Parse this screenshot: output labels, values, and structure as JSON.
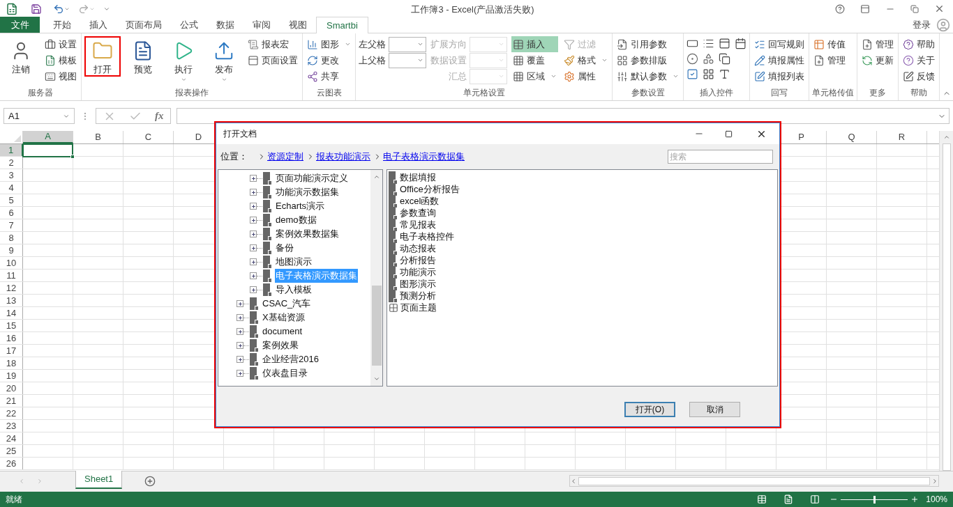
{
  "title_bar": {
    "title": "工作簿3 - Excel(产品激活失败)"
  },
  "tabs": [
    {
      "label": "文件",
      "kind": "file",
      "selected": false
    },
    {
      "label": "开始",
      "kind": "tab",
      "selected": false
    },
    {
      "label": "插入",
      "kind": "tab",
      "selected": false
    },
    {
      "label": "页面布局",
      "kind": "tab",
      "selected": false
    },
    {
      "label": "公式",
      "kind": "tab",
      "selected": false
    },
    {
      "label": "数据",
      "kind": "tab",
      "selected": false
    },
    {
      "label": "审阅",
      "kind": "tab",
      "selected": false
    },
    {
      "label": "视图",
      "kind": "tab",
      "selected": false
    },
    {
      "label": "Smartbi",
      "kind": "tab",
      "selected": true
    }
  ],
  "account": {
    "label": "登录"
  },
  "ribbon": {
    "groups": [
      {
        "label": "服务器",
        "columns": [
          {
            "kind": "large",
            "label": "注销",
            "highlighted": false,
            "has_caret": false
          },
          {
            "kind": "stack",
            "items": [
              {
                "label": "设置",
                "disabled": false,
                "selected": false,
                "has_caret": false
              },
              {
                "label": "模板",
                "disabled": false,
                "selected": false,
                "has_caret": false
              },
              {
                "label": "视图",
                "disabled": false,
                "selected": false,
                "has_caret": false
              }
            ]
          }
        ]
      },
      {
        "label": "报表操作",
        "columns": [
          {
            "kind": "large",
            "label": "打开",
            "highlighted": true,
            "has_caret": false
          },
          {
            "kind": "large",
            "label": "预览",
            "highlighted": false,
            "has_caret": false
          },
          {
            "kind": "large",
            "label": "执行",
            "highlighted": false,
            "has_caret": true
          },
          {
            "kind": "large",
            "label": "发布",
            "highlighted": false,
            "has_caret": true
          },
          {
            "kind": "stack",
            "items": [
              {
                "label": "报表宏",
                "disabled": false,
                "selected": false,
                "has_caret": false
              },
              {
                "label": "页面设置",
                "disabled": false,
                "selected": false,
                "has_caret": false
              }
            ]
          }
        ]
      },
      {
        "label": "云图表",
        "columns": [
          {
            "kind": "stack",
            "items": [
              {
                "label": "图形",
                "disabled": false,
                "selected": false,
                "has_caret": true
              },
              {
                "label": "更改",
                "disabled": false,
                "selected": false,
                "has_caret": false
              },
              {
                "label": "共享",
                "disabled": false,
                "selected": false,
                "has_caret": false
              }
            ]
          }
        ]
      },
      {
        "label": "单元格设置",
        "columns": [
          {
            "kind": "fields",
            "items": [
              {
                "label": "左父格",
                "disabled": false
              },
              {
                "label": "上父格",
                "disabled": false
              }
            ]
          },
          {
            "kind": "fields",
            "items": [
              {
                "label": "扩展方向",
                "disabled": true
              },
              {
                "label": "数据设置",
                "disabled": true
              },
              {
                "label": "汇总",
                "disabled": true
              }
            ]
          },
          {
            "kind": "stack",
            "items": [
              {
                "label": "插入",
                "disabled": false,
                "selected": true,
                "has_caret": false
              },
              {
                "label": "覆盖",
                "disabled": false,
                "selected": false,
                "has_caret": false
              },
              {
                "label": "区域",
                "disabled": false,
                "selected": false,
                "has_caret": true
              }
            ]
          },
          {
            "kind": "stack",
            "items": [
              {
                "label": "过滤",
                "disabled": true,
                "selected": false,
                "has_caret": false
              },
              {
                "label": "格式",
                "disabled": false,
                "selected": false,
                "has_caret": true
              },
              {
                "label": "属性",
                "disabled": false,
                "selected": false,
                "has_caret": false
              }
            ]
          }
        ]
      },
      {
        "label": "参数设置",
        "columns": [
          {
            "kind": "stack",
            "items": [
              {
                "label": "引用参数",
                "disabled": false,
                "selected": false,
                "has_caret": false
              },
              {
                "label": "参数排版",
                "disabled": false,
                "selected": false,
                "has_caret": false
              },
              {
                "label": "默认参数",
                "disabled": false,
                "selected": false,
                "has_caret": true
              }
            ]
          }
        ]
      },
      {
        "label": "插入控件",
        "columns": [
          {
            "kind": "icon_grid"
          }
        ]
      },
      {
        "label": "回写",
        "columns": [
          {
            "kind": "stack",
            "items": [
              {
                "label": "回写规则",
                "disabled": false,
                "selected": false,
                "has_caret": false
              },
              {
                "label": "填报属性",
                "disabled": false,
                "selected": false,
                "has_caret": false
              },
              {
                "label": "填报列表",
                "disabled": false,
                "selected": false,
                "has_caret": false
              }
            ]
          }
        ]
      },
      {
        "label": "单元格传值",
        "columns": [
          {
            "kind": "stack",
            "items": [
              {
                "label": "传值",
                "disabled": false,
                "selected": false,
                "has_caret": false
              },
              {
                "label": "管理",
                "disabled": false,
                "selected": false,
                "has_caret": false
              }
            ]
          }
        ]
      },
      {
        "label": "更多",
        "columns": [
          {
            "kind": "stack",
            "items": [
              {
                "label": "管理",
                "disabled": false,
                "selected": false,
                "has_caret": false
              },
              {
                "label": "更新",
                "disabled": false,
                "selected": false,
                "has_caret": false
              }
            ]
          }
        ]
      },
      {
        "label": "帮助",
        "columns": [
          {
            "kind": "stack",
            "items": [
              {
                "label": "帮助",
                "disabled": false,
                "selected": false,
                "has_caret": false
              },
              {
                "label": "关于",
                "disabled": false,
                "selected": false,
                "has_caret": false
              },
              {
                "label": "反馈",
                "disabled": false,
                "selected": false,
                "has_caret": false
              }
            ]
          }
        ]
      }
    ]
  },
  "formula_bar": {
    "name_box": "A1",
    "function_button": "fx"
  },
  "sheet": {
    "columns": [
      {
        "label": "A",
        "selected": true
      },
      {
        "label": "B",
        "selected": false
      },
      {
        "label": "C",
        "selected": false
      },
      {
        "label": "D",
        "selected": false
      },
      {
        "label": "P",
        "selected": false
      },
      {
        "label": "Q",
        "selected": false
      },
      {
        "label": "R",
        "selected": false
      }
    ],
    "rows": [
      {
        "label": "1",
        "selected": true
      },
      {
        "label": "2",
        "selected": false
      },
      {
        "label": "3",
        "selected": false
      },
      {
        "label": "4",
        "selected": false
      },
      {
        "label": "5",
        "selected": false
      },
      {
        "label": "6",
        "selected": false
      },
      {
        "label": "7",
        "selected": false
      },
      {
        "label": "8",
        "selected": false
      },
      {
        "label": "9",
        "selected": false
      },
      {
        "label": "10",
        "selected": false
      },
      {
        "label": "11",
        "selected": false
      },
      {
        "label": "12",
        "selected": false
      },
      {
        "label": "13",
        "selected": false
      },
      {
        "label": "14",
        "selected": false
      },
      {
        "label": "15",
        "selected": false
      },
      {
        "label": "16",
        "selected": false
      },
      {
        "label": "17",
        "selected": false
      },
      {
        "label": "18",
        "selected": false
      },
      {
        "label": "19",
        "selected": false
      },
      {
        "label": "20",
        "selected": false
      },
      {
        "label": "21",
        "selected": false
      },
      {
        "label": "22",
        "selected": false
      },
      {
        "label": "23",
        "selected": false
      },
      {
        "label": "24",
        "selected": false
      },
      {
        "label": "25",
        "selected": false
      },
      {
        "label": "26",
        "selected": false
      }
    ]
  },
  "sheet_tabs": [
    {
      "label": "Sheet1",
      "selected": true
    }
  ],
  "status_bar": {
    "status": "就绪",
    "zoom": {
      "label": "100%",
      "level": 0.5
    }
  },
  "dialog": {
    "title": "打开文档",
    "location_label": "位置：",
    "breadcrumb": [
      "资源定制",
      "报表功能演示",
      "电子表格演示数据集"
    ],
    "search": {
      "placeholder": "搜索"
    },
    "tree": [
      {
        "children": [
          {
            "label": "页面功能演示定义",
            "selected": false,
            "expanded": false
          },
          {
            "label": "功能演示数据集",
            "selected": false,
            "expanded": false
          },
          {
            "label": "Echarts演示",
            "selected": false,
            "expanded": false
          },
          {
            "label": "demo数据",
            "selected": false,
            "expanded": false
          },
          {
            "label": "案例效果数据集",
            "selected": false,
            "expanded": false
          },
          {
            "label": "备份",
            "selected": false,
            "expanded": false
          },
          {
            "label": "地图演示",
            "selected": false,
            "expanded": false
          },
          {
            "label": "电子表格演示数据集",
            "selected": true,
            "expanded": false
          },
          {
            "label": "导入模板",
            "selected": false,
            "expanded": false
          }
        ]
      },
      {
        "label": "CSAC_汽车",
        "selected": false,
        "expanded": false
      },
      {
        "label": "X基础资源",
        "selected": false,
        "expanded": false
      },
      {
        "label": "document",
        "selected": false,
        "expanded": false
      },
      {
        "label": "案例效果",
        "selected": false,
        "expanded": false
      },
      {
        "label": "企业经营2016",
        "selected": false,
        "expanded": false
      },
      {
        "label": "仪表盘目录",
        "selected": false,
        "expanded": false
      }
    ],
    "items": [
      {
        "label": "数据填报",
        "kind": "folder"
      },
      {
        "label": "Office分析报告",
        "kind": "folder"
      },
      {
        "label": "excel函数",
        "kind": "folder"
      },
      {
        "label": "参数查询",
        "kind": "folder"
      },
      {
        "label": "常见报表",
        "kind": "folder"
      },
      {
        "label": "电子表格控件",
        "kind": "folder"
      },
      {
        "label": "动态报表",
        "kind": "folder"
      },
      {
        "label": "分析报告",
        "kind": "folder"
      },
      {
        "label": "功能演示",
        "kind": "folder"
      },
      {
        "label": "图形演示",
        "kind": "folder"
      },
      {
        "label": "预测分析",
        "kind": "folder"
      },
      {
        "label": "页面主题",
        "kind": "page"
      }
    ],
    "buttons": [
      {
        "label": "打开(O)",
        "default": true
      },
      {
        "label": "取消",
        "default": false
      }
    ]
  }
}
